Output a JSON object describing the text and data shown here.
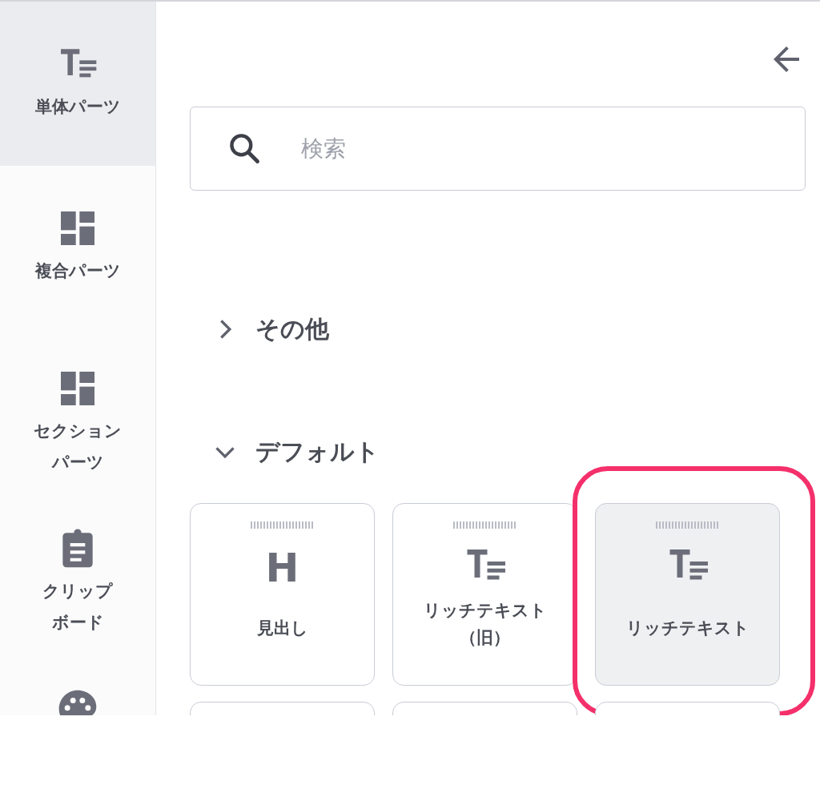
{
  "sidebar": {
    "items": [
      {
        "kind": "text",
        "label_lines": [
          "単体パーツ"
        ],
        "selected": true
      },
      {
        "kind": "grid",
        "label_lines": [
          "複合パーツ"
        ],
        "selected": false
      },
      {
        "kind": "grid",
        "label_lines": [
          "セクション",
          "パーツ"
        ],
        "selected": false
      },
      {
        "kind": "clipboard",
        "label_lines": [
          "クリップ",
          "ボード"
        ],
        "selected": false
      },
      {
        "kind": "palette",
        "selected": false
      }
    ]
  },
  "search": {
    "placeholder": "検索"
  },
  "groups": [
    {
      "title": "その他",
      "expanded": false
    },
    {
      "title": "デフォルト",
      "expanded": true,
      "cards": [
        {
          "kind": "heading",
          "glyph": "H",
          "label_lines": [
            "見出し"
          ],
          "highlighted": false
        },
        {
          "kind": "richtext",
          "label_lines": [
            "リッチテキスト",
            "（旧）"
          ],
          "highlighted": false
        },
        {
          "kind": "richtext",
          "label_lines": [
            "リッチテキスト"
          ],
          "highlighted": true
        }
      ]
    }
  ]
}
